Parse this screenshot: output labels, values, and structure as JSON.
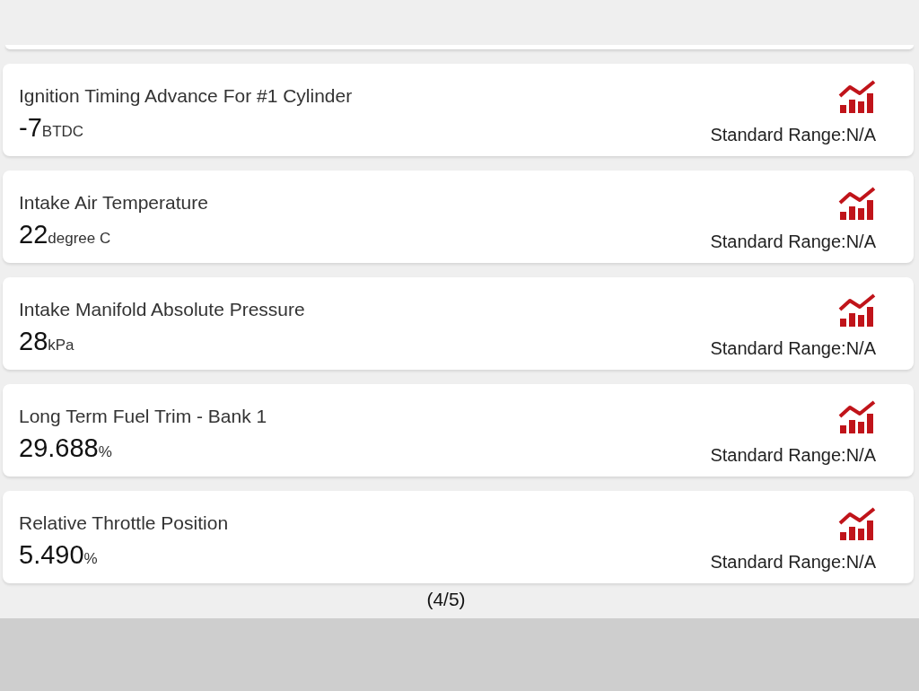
{
  "parameters": [
    {
      "name": "Ignition Timing Advance For #1 Cylinder",
      "value": "-7",
      "unit": "BTDC",
      "standard_range": "Standard Range:N/A"
    },
    {
      "name": "Intake Air Temperature",
      "value": "22",
      "unit": "degree C",
      "standard_range": "Standard Range:N/A"
    },
    {
      "name": "Intake Manifold Absolute Pressure",
      "value": "28",
      "unit": "kPa",
      "standard_range": "Standard Range:N/A"
    },
    {
      "name": "Long Term Fuel Trim - Bank 1",
      "value": "29.688",
      "unit": "%",
      "standard_range": "Standard Range:N/A"
    },
    {
      "name": "Relative Throttle Position",
      "value": "5.490",
      "unit": "%",
      "standard_range": "Standard Range:N/A"
    }
  ],
  "page_indicator": "(4/5)"
}
